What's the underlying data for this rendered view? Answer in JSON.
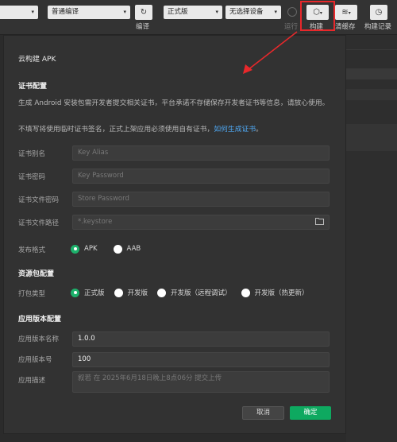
{
  "toolbar": {
    "compile_mode": "普通编译",
    "compile_label": "编译",
    "version": "正式版",
    "device": "无选择设备",
    "run_label": "运行",
    "build_label": "构建",
    "clear_cache_label": "清缓存",
    "build_history_label": "构建记录"
  },
  "dialog": {
    "title": "云构建 APK",
    "cert_section": "证书配置",
    "cert_desc_1": "生成 Android 安装包需开发者提交相关证书，平台承诺不存储保存开发者证书等信息，请放心使用。",
    "cert_desc_2": "不填写将使用临时证书签名，正式上架应用必须使用自有证书，",
    "cert_link": "如何生成证书",
    "cert_desc_2_end": "。",
    "cert_alias_label": "证书别名",
    "cert_alias_placeholder": "Key Alias",
    "cert_password_label": "证书密码",
    "cert_password_placeholder": "Key Password",
    "store_password_label": "证书文件密码",
    "store_password_placeholder": "Store Password",
    "cert_path_label": "证书文件路径",
    "cert_path_placeholder": "*.keystore",
    "format_label": "发布格式",
    "format_options": [
      "APK",
      "AAB"
    ],
    "format_selected": "APK",
    "res_section": "资源包配置",
    "pack_type_label": "打包类型",
    "pack_options": [
      "正式版",
      "开发版",
      "开发版（远程调试）",
      "开发版（热更新）"
    ],
    "pack_selected": "正式版",
    "version_section": "应用版本配置",
    "version_name_label": "应用版本名称",
    "version_name_value": "1.0.0",
    "version_code_label": "应用版本号",
    "version_code_value": "100",
    "app_desc_label": "应用描述",
    "app_desc_placeholder": "叙若 在 2025年6月18日晚上8点06分 提交上传",
    "cancel_label": "取消",
    "ok_label": "确定"
  },
  "colors": {
    "accent_green": "#0ea960",
    "link_blue": "#4fa8f3",
    "annotation_red": "#e8282b"
  }
}
